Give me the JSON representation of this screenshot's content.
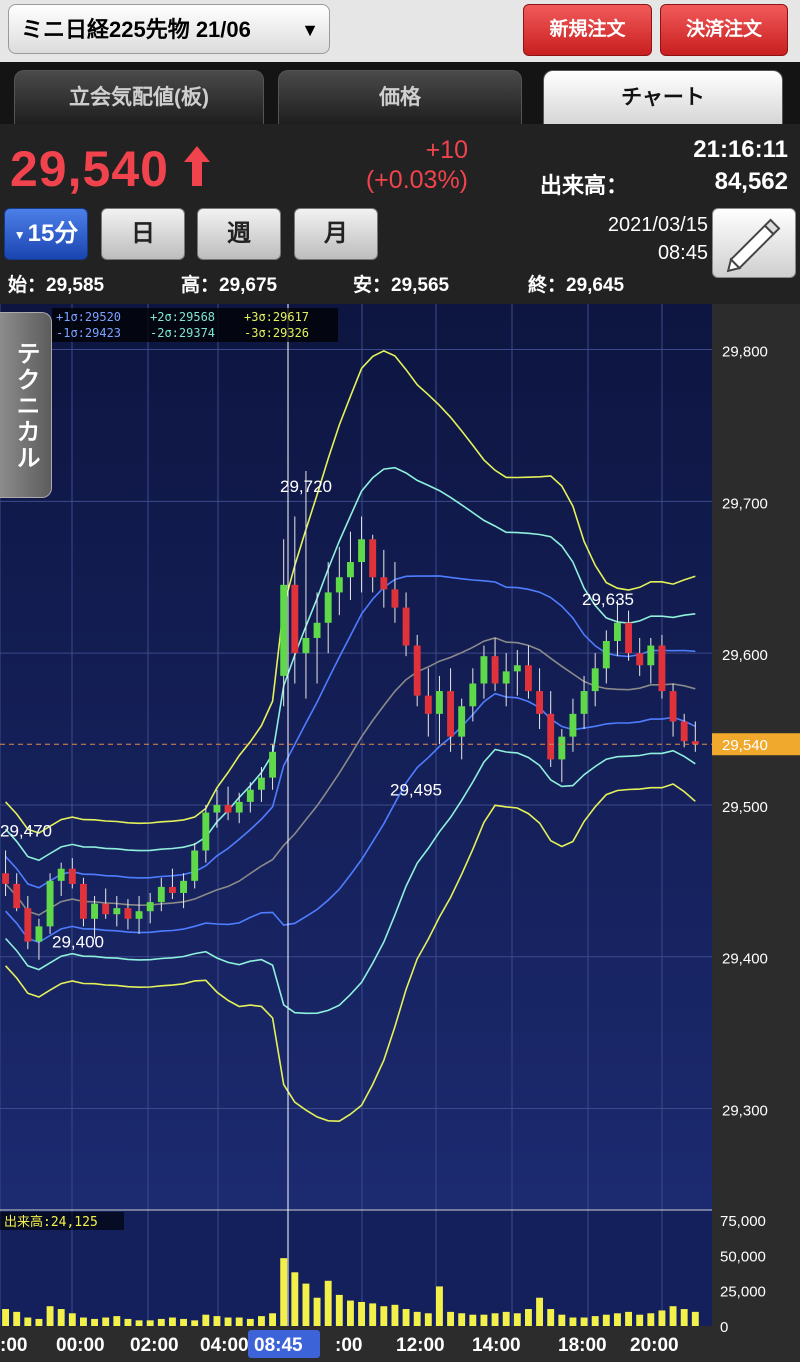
{
  "header": {
    "symbol": "ミニ日経225先物 21/06",
    "caret": "▼",
    "new_order": "新規注文",
    "settle_order": "決済注文"
  },
  "tabs": [
    {
      "label": "立会気配値(板)"
    },
    {
      "label": "価格"
    },
    {
      "label": "チャート",
      "active": true
    }
  ],
  "quote": {
    "last": "29,540",
    "change": "+10",
    "change_pct": "(+0.03%)",
    "time": "21:16:11",
    "volume_label": "出来高：",
    "volume": "84,562",
    "up_color": "#f0434d"
  },
  "periods": [
    {
      "label": "15分",
      "active": true
    },
    {
      "label": "日"
    },
    {
      "label": "週"
    },
    {
      "label": "月"
    }
  ],
  "cursor": {
    "date": "2021/03/15",
    "time": "08:45"
  },
  "ohlc": {
    "open": "始：29,585",
    "high": "高：29,675",
    "low": "安：29,565",
    "close": "終：29,645"
  },
  "technical_tab": "テクニカル",
  "chart_data": {
    "type": "candlestick",
    "legend": {
      "row1": [
        {
          "text": "+1σ:29520",
          "color": "#7aa2ff"
        },
        {
          "text": "+2σ:29568",
          "color": "#7fe6d2"
        },
        {
          "text": "+3σ:29617",
          "color": "#e4f25a"
        }
      ],
      "row2": [
        {
          "text": "-1σ:29423",
          "color": "#7aa2ff"
        },
        {
          "text": "-2σ:29374",
          "color": "#7fe6d2"
        },
        {
          "text": "-3σ:29326",
          "color": "#e4f25a"
        }
      ]
    },
    "y_ticks": [
      "29,800",
      "29,700",
      "29,600",
      "29,500",
      "29,400",
      "29,300"
    ],
    "y_tick_values": [
      29800,
      29700,
      29600,
      29500,
      29400,
      29300
    ],
    "current_price_tag": "29,540",
    "current_price": 29540,
    "annotations": [
      {
        "text": "29,720",
        "value": 29720
      },
      {
        "text": "29,635",
        "value": 29635
      },
      {
        "text": "29,495",
        "value": 29495
      },
      {
        "text": "29,470",
        "value": 29470
      },
      {
        "text": "29,400",
        "value": 29400
      }
    ],
    "x_labels": [
      ":00",
      "00:00",
      "02:00",
      "04:00",
      "08:45",
      ":00",
      "12:00",
      "14:00",
      "18:00",
      "20:00"
    ],
    "volume_label": "出来高:24,125",
    "volume_ticks": [
      "75,000",
      "50,000",
      "25,000",
      "0"
    ],
    "candles": [
      [
        29455,
        29470,
        29440,
        29448
      ],
      [
        29448,
        29455,
        29430,
        29432
      ],
      [
        29432,
        29440,
        29405,
        29410
      ],
      [
        29410,
        29425,
        29398,
        29420
      ],
      [
        29420,
        29455,
        29415,
        29450
      ],
      [
        29450,
        29462,
        29440,
        29458
      ],
      [
        29458,
        29465,
        29445,
        29448
      ],
      [
        29448,
        29452,
        29420,
        29425
      ],
      [
        29425,
        29440,
        29412,
        29435
      ],
      [
        29435,
        29445,
        29425,
        29428
      ],
      [
        29428,
        29440,
        29420,
        29432
      ],
      [
        29432,
        29438,
        29418,
        29425
      ],
      [
        29425,
        29440,
        29415,
        29430
      ],
      [
        29430,
        29442,
        29422,
        29436
      ],
      [
        29436,
        29452,
        29430,
        29446
      ],
      [
        29446,
        29458,
        29438,
        29442
      ],
      [
        29442,
        29455,
        29432,
        29450
      ],
      [
        29450,
        29475,
        29445,
        29470
      ],
      [
        29470,
        29500,
        29462,
        29495
      ],
      [
        29495,
        29510,
        29485,
        29500
      ],
      [
        29500,
        29512,
        29490,
        29495
      ],
      [
        29495,
        29508,
        29488,
        29502
      ],
      [
        29502,
        29515,
        29495,
        29510
      ],
      [
        29510,
        29525,
        29502,
        29518
      ],
      [
        29518,
        29540,
        29510,
        29535
      ],
      [
        29585,
        29675,
        29565,
        29645
      ],
      [
        29645,
        29690,
        29580,
        29600
      ],
      [
        29600,
        29720,
        29570,
        29610
      ],
      [
        29610,
        29640,
        29580,
        29620
      ],
      [
        29620,
        29660,
        29600,
        29640
      ],
      [
        29640,
        29670,
        29625,
        29650
      ],
      [
        29650,
        29680,
        29635,
        29660
      ],
      [
        29660,
        29690,
        29640,
        29675
      ],
      [
        29675,
        29678,
        29640,
        29650
      ],
      [
        29650,
        29668,
        29630,
        29642
      ],
      [
        29642,
        29660,
        29620,
        29630
      ],
      [
        29630,
        29640,
        29598,
        29605
      ],
      [
        29605,
        29612,
        29565,
        29572
      ],
      [
        29572,
        29590,
        29545,
        29560
      ],
      [
        29560,
        29585,
        29540,
        29575
      ],
      [
        29575,
        29590,
        29535,
        29545
      ],
      [
        29545,
        29570,
        29530,
        29565
      ],
      [
        29565,
        29590,
        29555,
        29580
      ],
      [
        29580,
        29605,
        29570,
        29598
      ],
      [
        29598,
        29610,
        29575,
        29580
      ],
      [
        29580,
        29600,
        29565,
        29588
      ],
      [
        29588,
        29602,
        29572,
        29592
      ],
      [
        29592,
        29605,
        29570,
        29575
      ],
      [
        29575,
        29590,
        29550,
        29560
      ],
      [
        29560,
        29575,
        29525,
        29530
      ],
      [
        29530,
        29550,
        29515,
        29545
      ],
      [
        29545,
        29570,
        29535,
        29560
      ],
      [
        29560,
        29585,
        29550,
        29575
      ],
      [
        29575,
        29600,
        29565,
        29590
      ],
      [
        29590,
        29615,
        29580,
        29608
      ],
      [
        29608,
        29635,
        29598,
        29620
      ],
      [
        29620,
        29628,
        29595,
        29600
      ],
      [
        29600,
        29610,
        29585,
        29592
      ],
      [
        29592,
        29610,
        29580,
        29605
      ],
      [
        29605,
        29612,
        29570,
        29575
      ],
      [
        29575,
        29580,
        29545,
        29555
      ],
      [
        29555,
        29560,
        29538,
        29542
      ],
      [
        29542,
        29555,
        29535,
        29540
      ]
    ],
    "volumes": [
      12000,
      10000,
      6000,
      5000,
      14000,
      12000,
      9000,
      6000,
      5000,
      6000,
      7000,
      5000,
      4000,
      4000,
      5000,
      6000,
      5000,
      4000,
      8000,
      7000,
      6000,
      6000,
      5000,
      7000,
      9000,
      48000,
      38000,
      30000,
      20000,
      32000,
      22000,
      18000,
      17000,
      16000,
      14000,
      15000,
      12000,
      10000,
      9000,
      28000,
      10000,
      9000,
      8000,
      8000,
      9000,
      10000,
      9000,
      12000,
      20000,
      12000,
      8000,
      6000,
      6000,
      7000,
      8000,
      9000,
      10000,
      8000,
      9000,
      11000,
      14000,
      12000,
      10000
    ]
  }
}
